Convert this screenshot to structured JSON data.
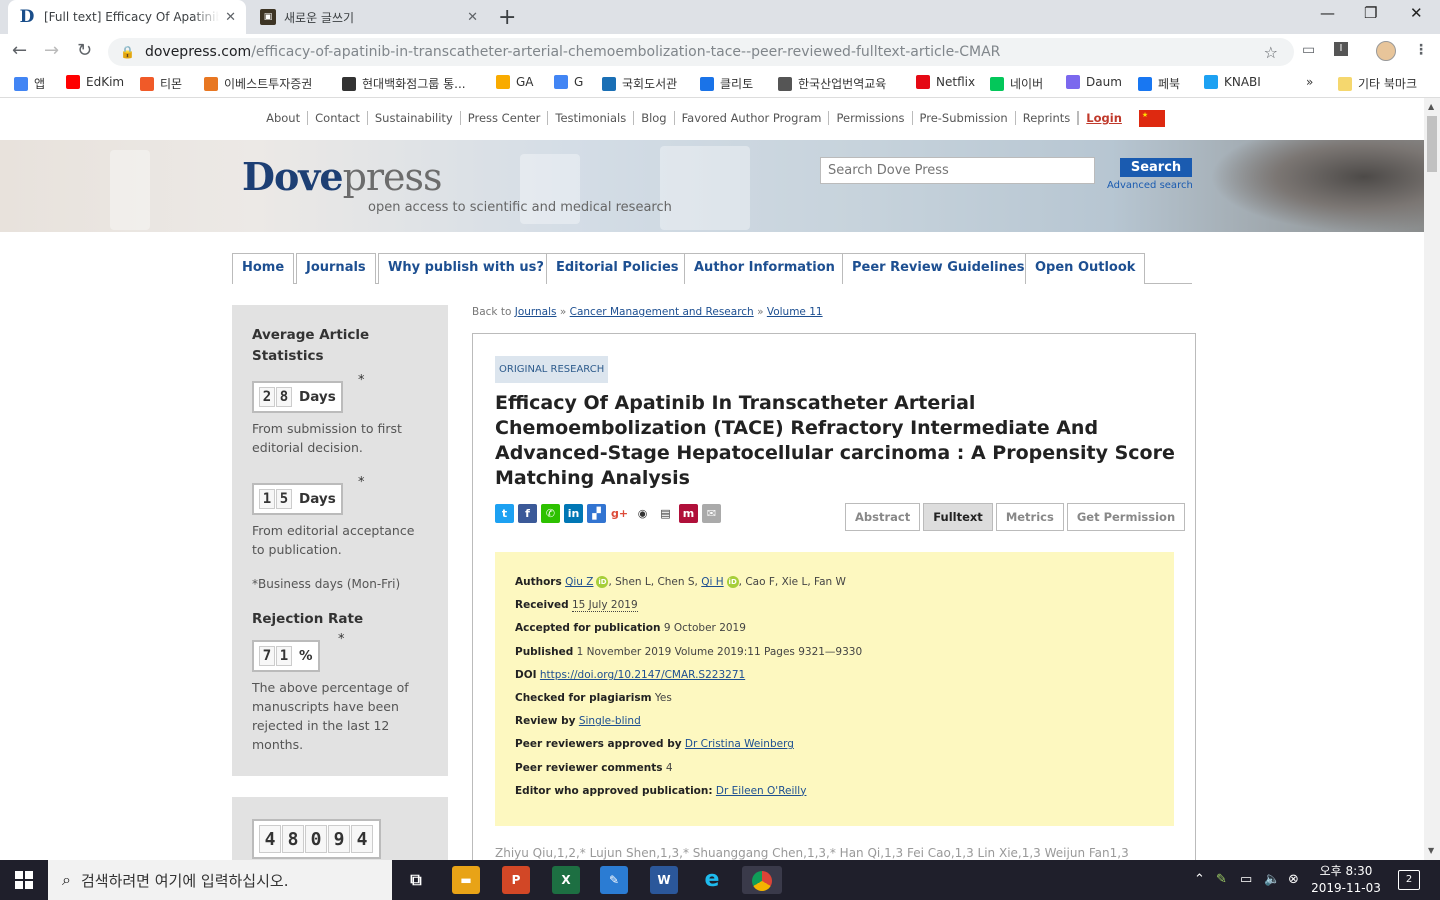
{
  "browser": {
    "tabs": [
      {
        "title": "[Full text] Efficacy Of Apatinib In Transcatheter Arterial",
        "favicon": "D"
      },
      {
        "title": "새로운 글쓰기",
        "favicon": "▣"
      }
    ],
    "url_host": "dovepress.com",
    "url_path": "/efficacy-of-apatinib-in-transcatheter-arterial-chemoembolization-tace--peer-reviewed-fulltext-article-CMAR",
    "bookmarks": [
      {
        "label": "앱",
        "color": "#4285f4"
      },
      {
        "label": "EdKim",
        "color": "#ff0000"
      },
      {
        "label": "티몬",
        "color": "#f05a28"
      },
      {
        "label": "이베스트투자증권",
        "color": "#e87722"
      },
      {
        "label": "현대백화점그룹 통...",
        "color": "#333333"
      },
      {
        "label": "GA",
        "color": "#f9ab00"
      },
      {
        "label": "G",
        "color": "#4285f4"
      },
      {
        "label": "국회도서관",
        "color": "#1a6fb5"
      },
      {
        "label": "클리토",
        "color": "#1a73e8"
      },
      {
        "label": "한국산업번역교육",
        "color": "#555555"
      },
      {
        "label": "Netflix",
        "color": "#e50914"
      },
      {
        "label": "네이버",
        "color": "#03c75a"
      },
      {
        "label": "Daum",
        "color": "#7b68ee"
      },
      {
        "label": "페북",
        "color": "#1877f2"
      },
      {
        "label": "KNABI",
        "color": "#1da1f2"
      }
    ],
    "bookmarks_more": "»",
    "other_bookmarks": "기타 북마크"
  },
  "site": {
    "topnav": [
      "About",
      "Contact",
      "Sustainability",
      "Press Center",
      "Testimonials",
      "Blog",
      "Favored Author Program",
      "Permissions",
      "Pre-Submission",
      "Reprints"
    ],
    "login": "Login",
    "logo_dove": "Dove",
    "logo_press": "press",
    "tagline": "open access to scientific and medical research",
    "search_placeholder": "Search Dove Press",
    "search_button": "Search",
    "advanced_search": "Advanced search",
    "mainnav": [
      "Home",
      "Journals",
      "Why publish with us?",
      "Editorial Policies",
      "Author Information",
      "Peer Review Guidelines",
      "Open Outlook"
    ]
  },
  "sidebar": {
    "heading": "Average Article Statistics",
    "stat1": {
      "digits": [
        "2",
        "8"
      ],
      "unit": "Days",
      "text": "From submission to first editorial decision."
    },
    "stat2": {
      "digits": [
        "1",
        "5"
      ],
      "unit": "Days",
      "text": "From editorial acceptance to publication."
    },
    "asterisk": "*",
    "business_days": "*Business days (Mon-Fri)",
    "rejection_heading": "Rejection Rate",
    "stat3": {
      "digits": [
        "7",
        "1"
      ],
      "unit": "%",
      "text": "The above percentage of manuscripts have been rejected in the last 12 months."
    },
    "counter_digits": [
      "4",
      "8",
      "0",
      "9",
      "4"
    ]
  },
  "breadcrumb": {
    "prefix": "Back to",
    "links": [
      "Journals",
      "Cancer Management and Research",
      "Volume 11"
    ],
    "sep": "»"
  },
  "article": {
    "badge": "ORIGINAL RESEARCH",
    "title": "Efficacy Of Apatinib In Transcatheter Arterial Chemoembolization (TACE) Refractory Intermediate And Advanced-Stage Hepatocellular carcinoma : A Propensity Score Matching Analysis",
    "tabs": [
      "Abstract",
      "Fulltext",
      "Metrics",
      "Get Permission"
    ],
    "active_tab": "Fulltext",
    "info": {
      "authors_label": "Authors",
      "author1": "Qiu Z",
      "author2_plain": ", Shen L, Chen S, ",
      "author3": "Qi H",
      "author4_plain": ", Cao F, Xie L, Fan W",
      "orcid": "iD",
      "received_label": "Received",
      "received": "15 July 2019",
      "accepted_label": "Accepted for publication",
      "accepted": "9 October 2019",
      "published_label": "Published",
      "published": "1 November 2019 Volume 2019:11 Pages 9321—9330",
      "doi_label": "DOI",
      "doi": "https://doi.org/10.2147/CMAR.S223271",
      "plagiarism_label": "Checked for plagiarism",
      "plagiarism": "Yes",
      "review_label": "Review by",
      "review": "Single-blind",
      "reviewers_label": "Peer reviewers approved by",
      "reviewers": "Dr Cristina Weinberg",
      "comments_label": "Peer reviewer comments",
      "comments": "4",
      "editor_label": "Editor who approved publication:",
      "editor": "Dr Eileen O'Reilly"
    },
    "authors_full": "Zhiyu Qiu,1,2,* Lujun Shen,1,3,* Shuanggang Chen,1,3,* Han Qi,1,3 Fei Cao,1,3 Lin Xie,1,3 Weijun Fan1,3"
  },
  "taskbar": {
    "search_placeholder": "검색하려면 여기에 입력하십시오.",
    "time": "오후 8:30",
    "date": "2019-11-03",
    "notifications": "2"
  }
}
